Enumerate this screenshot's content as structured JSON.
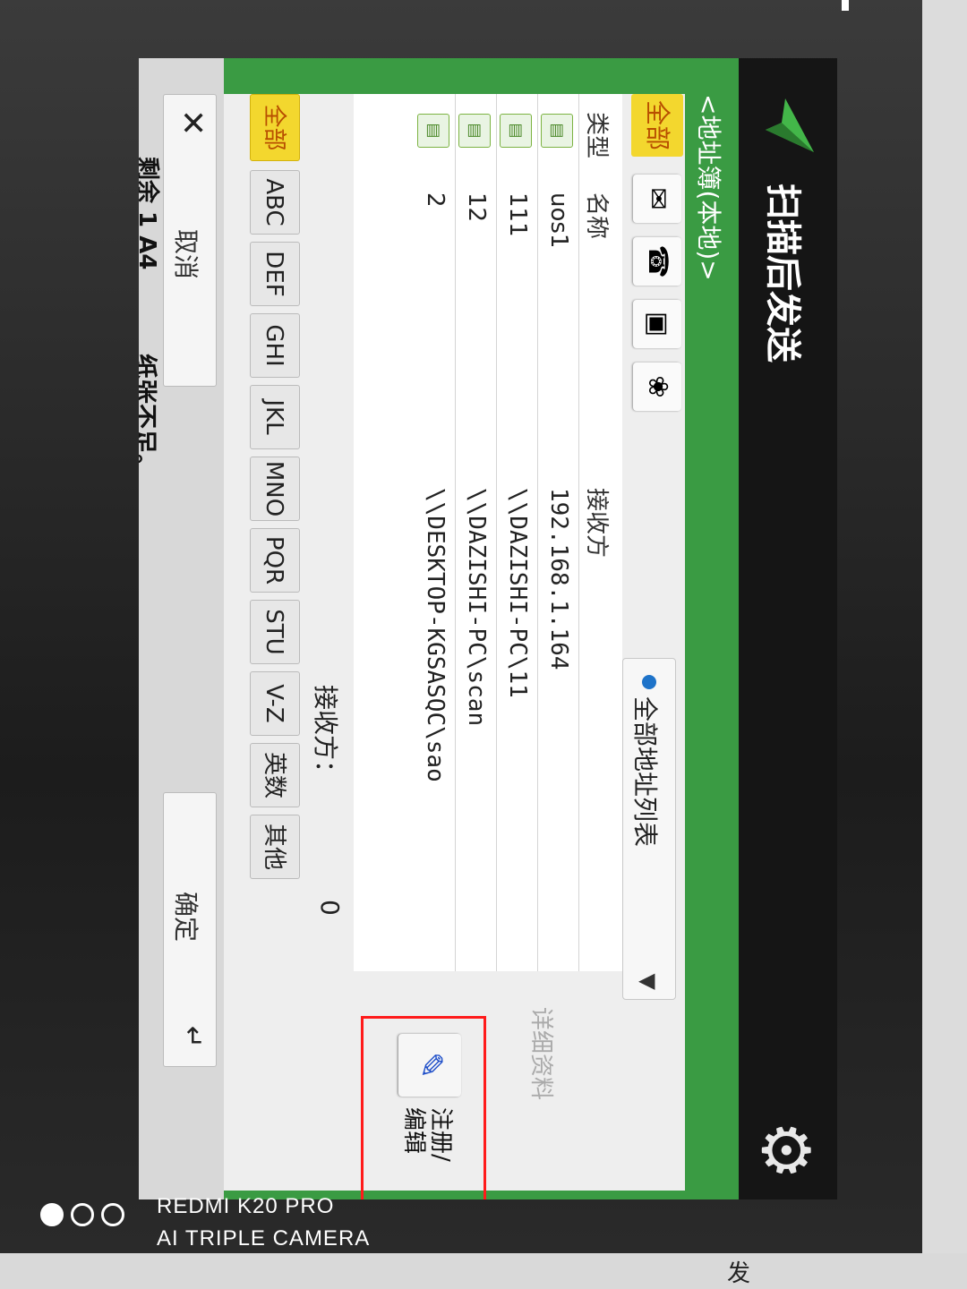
{
  "title": "扫描后发送",
  "subtitle": "<地址簿(本地)>",
  "toolbar": {
    "all_label": "全部"
  },
  "dropdown": {
    "value": "全部地址列表"
  },
  "detail_label": "详细资料",
  "register_label": "注册/编辑",
  "table": {
    "headers": {
      "type": "类型",
      "name": "名称",
      "recipient": "接收方"
    },
    "rows": [
      {
        "name": "uos1",
        "recipient": "192.168.1.164"
      },
      {
        "name": "111",
        "recipient": "\\\\DAZISHI-PC\\11"
      },
      {
        "name": "12",
        "recipient": "\\\\DAZISHI-PC\\scan"
      },
      {
        "name": "2",
        "recipient": "\\\\DESKTOP-KGSASQC\\sao"
      }
    ]
  },
  "recipient_count": {
    "label": "接收方：",
    "value": "0"
  },
  "letters": [
    "全部",
    "ABC",
    "DEF",
    "GHI",
    "JKL",
    "MNO",
    "PQR",
    "STU",
    "V-Z",
    "英数",
    "其他"
  ],
  "buttons": {
    "cancel": "取消",
    "ok": "确定"
  },
  "status": {
    "remaining": "剩余 1  A4",
    "message": "纸张不足。"
  },
  "watermark": {
    "line1": "REDMI K20 PRO",
    "line2": "AI TRIPLE CAMERA"
  },
  "side_text": "发"
}
